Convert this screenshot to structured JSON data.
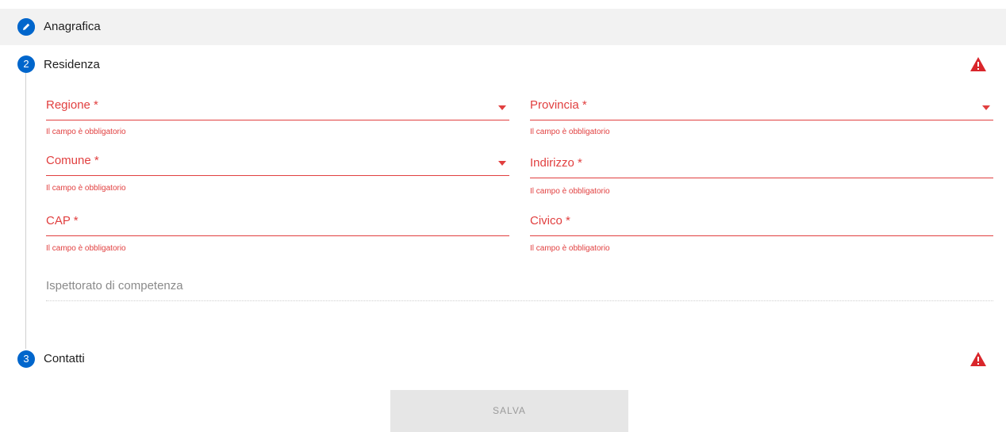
{
  "steps": [
    {
      "number": "",
      "label": "Anagrafica",
      "state": "completed",
      "icon": "pencil-icon"
    },
    {
      "number": "2",
      "label": "Residenza",
      "state": "active-error",
      "icon": "warning-icon"
    },
    {
      "number": "3",
      "label": "Contatti",
      "state": "error",
      "icon": "warning-icon"
    }
  ],
  "residenza": {
    "regione": {
      "label": "Regione *",
      "error": "Il campo è obbligatorio"
    },
    "provincia": {
      "label": "Provincia *",
      "error": "Il campo è obbligatorio"
    },
    "comune": {
      "label": "Comune *",
      "error": "Il campo è obbligatorio"
    },
    "indirizzo": {
      "label": "Indirizzo *",
      "error": "Il campo è obbligatorio"
    },
    "cap": {
      "label": "CAP *",
      "error": "Il campo è obbligatorio"
    },
    "civico": {
      "label": "Civico *",
      "error": "Il campo è obbligatorio"
    },
    "ispettorato": {
      "label": "Ispettorato di competenza"
    }
  },
  "actions": {
    "salva_label": "SALVA"
  },
  "colors": {
    "accent": "#0066cc",
    "error": "#e13f3f",
    "warning": "#d9262b",
    "disabled_bg": "#e6e6e6"
  }
}
